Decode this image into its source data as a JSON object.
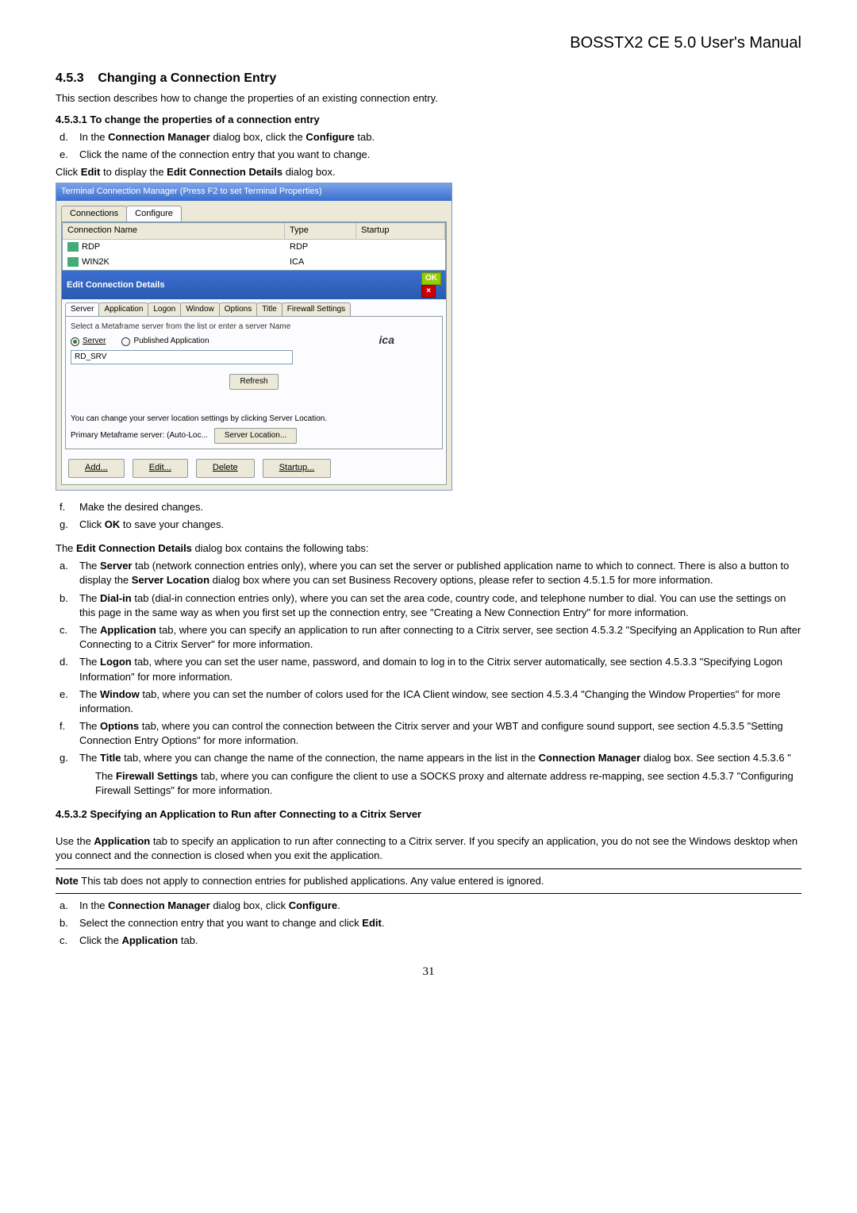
{
  "doc_title": "BOSSTX2 CE 5.0 User's Manual",
  "section": {
    "num": "4.5.3",
    "title": "Changing a Connection Entry",
    "intro": "This section describes how to change the properties of an existing connection entry.",
    "sub1_title": "4.5.3.1  To change the properties of a connection entry",
    "step_d_pre": "In the ",
    "step_d_bold": "Connection Manager",
    "step_d_mid": " dialog box, click the ",
    "step_d_bold2": "Configure",
    "step_d_post": " tab.",
    "step_e": "Click the name of the connection entry that you want to change.",
    "click_edit_pre": "Click ",
    "click_edit_b1": "Edit",
    "click_edit_mid": " to display the ",
    "click_edit_b2": "Edit Connection Details",
    "click_edit_post": " dialog box.",
    "step_f": "Make the desired changes.",
    "step_g_pre": "Click ",
    "step_g_bold": "OK",
    "step_g_post": " to save your changes.",
    "tabs_intro_pre": "The ",
    "tabs_intro_bold": "Edit Connection Details",
    "tabs_intro_post": " dialog box contains the following tabs:",
    "tab_a": {
      "pre": "The ",
      "b1": "Server",
      "mid1": " tab (network connection entries only), where you can set the server or published application name to which to connect. There is also a button to display the ",
      "b2": "Server Location",
      "post": " dialog box where you can set Business Recovery options, please refer to section 4.5.1.5 for more information."
    },
    "tab_b": {
      "pre": "The ",
      "b1": "Dial-in",
      "post": " tab (dial-in connection entries only), where you can set the area code, country code, and telephone number to dial. You can use the settings on this page in the same way as when you first set up the connection entry, see \"Creating a New Connection Entry\" for more information."
    },
    "tab_c": {
      "pre": "The ",
      "b1": "Application",
      "post": " tab, where you can specify an application to run after connecting to a Citrix server, see section 4.5.3.2 \"Specifying an Application to Run after Connecting to a Citrix Server\" for more information."
    },
    "tab_d": {
      "pre": "The ",
      "b1": "Logon",
      "post": " tab, where you can set the user name, password, and domain to log in to the Citrix server automatically, see section 4.5.3.3 \"Specifying Logon Information\" for more information."
    },
    "tab_e": {
      "pre": "The ",
      "b1": "Window",
      "post": " tab, where you can set the number of colors used for the ICA Client window, see section 4.5.3.4 \"Changing the Window Properties\" for more information."
    },
    "tab_f": {
      "pre": "The ",
      "b1": "Options",
      "post": " tab, where you can control the connection between the Citrix server and your WBT and configure sound support, see section 4.5.3.5 \"Setting Connection Entry Options\" for more information."
    },
    "tab_g": {
      "pre": "The ",
      "b1": "Title",
      "mid": " tab, where you can change the name of the connection, the name appears in the list in the ",
      "b2": "Connection Manager",
      "post": " dialog box. See section 4.5.3.6 \""
    },
    "firewall": {
      "pre": "The ",
      "b1": "Firewall Settings",
      "post": " tab, where you can configure the client to use a SOCKS proxy and alternate address re-mapping, see section 4.5.3.7 \"Configuring Firewall Settings\" for more information."
    },
    "sub2_title": "4.5.3.2  Specifying an Application to Run after Connecting to a Citrix Server",
    "sub2_para_pre": "Use the ",
    "sub2_para_b": "Application",
    "sub2_para_post": " tab to specify an application to run after connecting to a Citrix server. If you specify an application, you do not see the Windows desktop when you connect and the connection is closed when you exit the application.",
    "note_label": "Note",
    "note_text": "  This tab does not apply to connection entries for published applications. Any value entered is ignored.",
    "s2a": {
      "pre": "In the ",
      "b1": "Connection Manager",
      "mid": " dialog box, click ",
      "b2": "Configure",
      "post": "."
    },
    "s2b": {
      "pre": "Select the connection entry that you want to change and click ",
      "b1": "Edit",
      "post": "."
    },
    "s2c": {
      "pre": "Click the ",
      "b1": "Application",
      "post": " tab."
    }
  },
  "win": {
    "outer_title": "Terminal Connection Manager  (Press F2 to set Terminal Properties)",
    "tabs": {
      "connections": "Connections",
      "configure": "Configure"
    },
    "cols": {
      "name": "Connection Name",
      "type": "Type",
      "startup": "Startup"
    },
    "rows": [
      {
        "name": "RDP",
        "type": "RDP",
        "startup": ""
      },
      {
        "name": "WIN2K",
        "type": "ICA",
        "startup": ""
      }
    ],
    "inner_title": "Edit Connection Details",
    "ok": "OK",
    "inner_tabs": [
      "Server",
      "Application",
      "Logon",
      "Window",
      "Options",
      "Title",
      "Firewall Settings"
    ],
    "hint": "Select a Metaframe server from the list or enter a server Name",
    "radio_server": "Server",
    "radio_pub": "Published Application",
    "ica": "ica",
    "dropdown_val": "RD_SRV",
    "refresh": "Refresh",
    "loc_note": "You can change your server location settings by clicking Server Location.",
    "primary": "Primary Metaframe server: (Auto-Loc...",
    "server_loc_btn": "Server Location...",
    "add": "Add...",
    "edit": "Edit...",
    "delete": "Delete",
    "startup_btn": "Startup..."
  },
  "page_num": "31"
}
